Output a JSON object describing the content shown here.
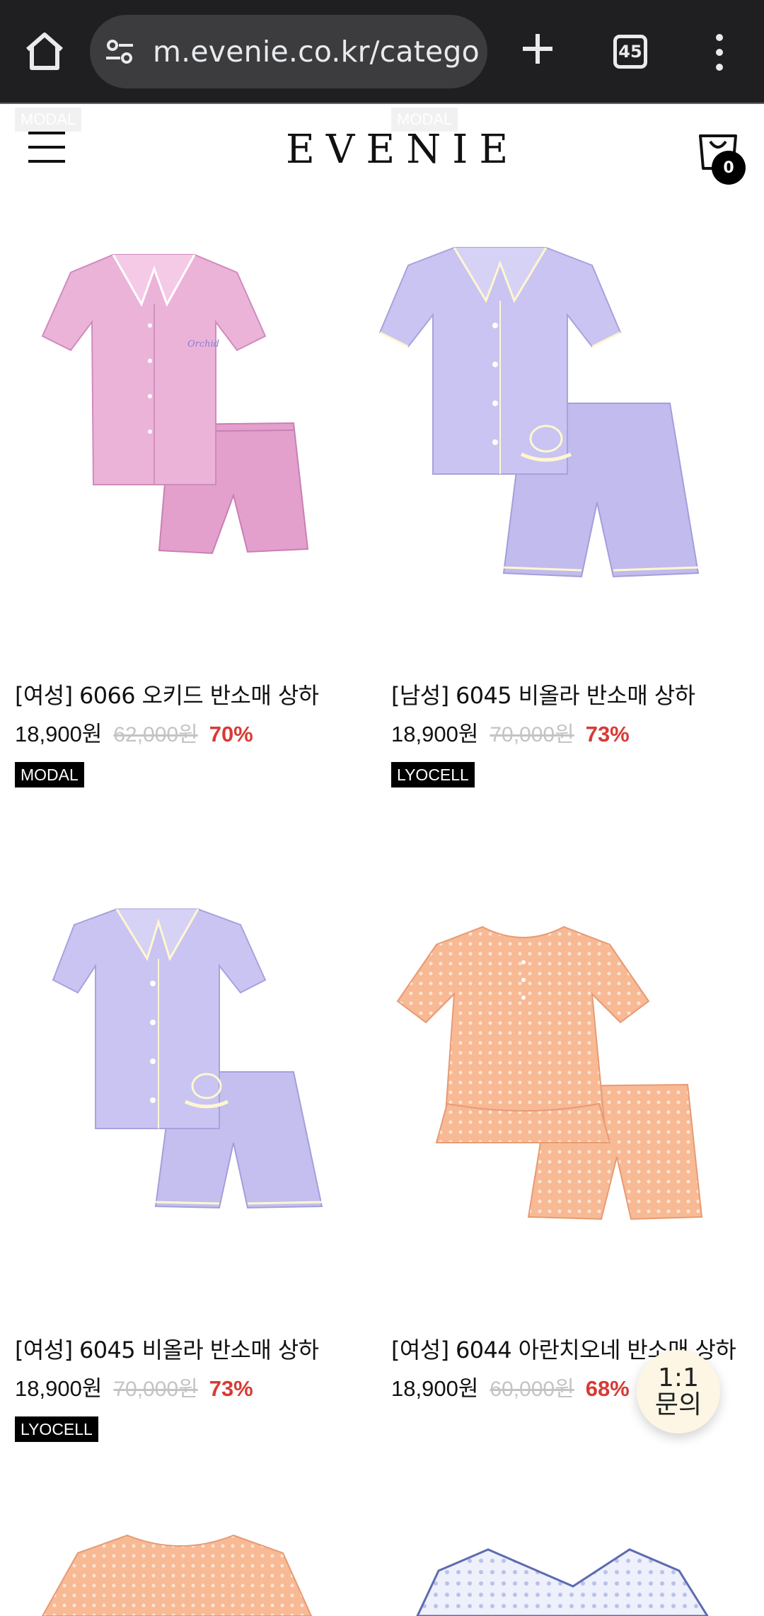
{
  "browser": {
    "url": "m.evenie.co.kr/catego",
    "tab_count": "45"
  },
  "header": {
    "logo": "EVENIE",
    "cart_count": "0",
    "ghost_tags": [
      "MODAL",
      "MODAL"
    ]
  },
  "products": [
    {
      "title": "[여성] 6066 오키드 반소매 상하",
      "price": "18,900원",
      "original_price": "62,000원",
      "discount": "70%",
      "badge": "MODAL",
      "color": "#e7a9d3"
    },
    {
      "title": "[남성] 6045 비올라 반소매 상하",
      "price": "18,900원",
      "original_price": "70,000원",
      "discount": "73%",
      "badge": "LYOCELL",
      "color": "#c4bfee"
    },
    {
      "title": "[여성] 6045 비올라 반소매 상하",
      "price": "18,900원",
      "original_price": "70,000원",
      "discount": "73%",
      "badge": "LYOCELL",
      "color": "#c4bfee"
    },
    {
      "title": "[여성] 6044 아란치오네 반소매 상하",
      "price": "18,900원",
      "original_price": "60,000원",
      "discount": "68%",
      "badge": "",
      "color": "#f8b995"
    }
  ],
  "chat_button": {
    "line1": "1:1",
    "line2": "문의"
  }
}
